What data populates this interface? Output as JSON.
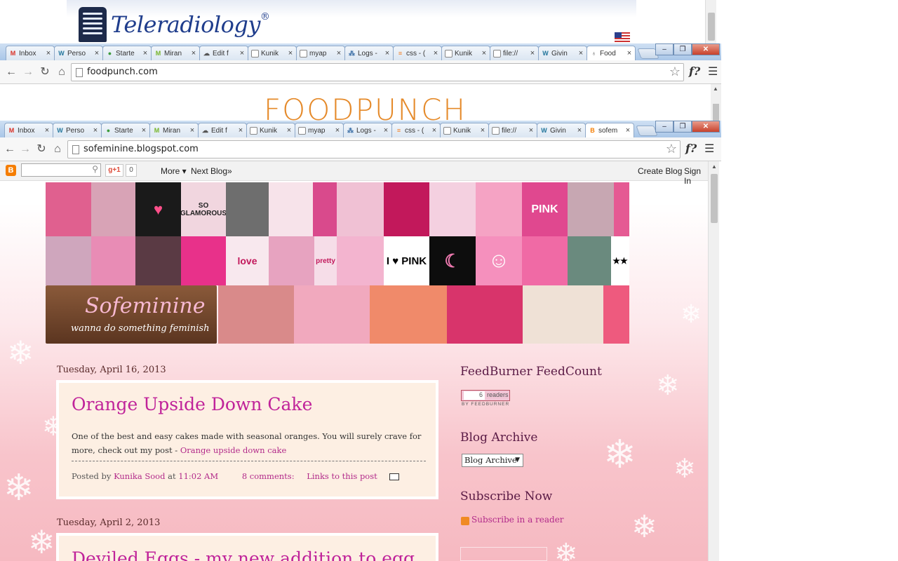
{
  "window1": {
    "logo_text": "Teleradiology",
    "logo_mark": "®"
  },
  "window2": {
    "tabs": [
      {
        "label": "Inbox",
        "icon": "gmail-icon"
      },
      {
        "label": "Perso",
        "icon": "wordpress-icon"
      },
      {
        "label": "Starte",
        "icon": "chrome-icon"
      },
      {
        "label": "Miran",
        "icon": "site-icon"
      },
      {
        "label": "Edit f",
        "icon": "cloud-icon"
      },
      {
        "label": "Kunik",
        "icon": "page-icon"
      },
      {
        "label": "myap",
        "icon": "page-icon"
      },
      {
        "label": "Logs -",
        "icon": "network-icon"
      },
      {
        "label": "css - (",
        "icon": "stack-icon"
      },
      {
        "label": "Kunik",
        "icon": "page-icon"
      },
      {
        "label": "file://",
        "icon": "page-icon"
      },
      {
        "label": "Givin",
        "icon": "wordpress-icon"
      },
      {
        "label": "Food",
        "icon": "foodpunch-icon"
      }
    ],
    "url": "foodpunch.com",
    "site_title": "FOODPUNCH"
  },
  "window3": {
    "tabs": [
      {
        "label": "Inbox",
        "icon": "gmail-icon"
      },
      {
        "label": "Perso",
        "icon": "wordpress-icon"
      },
      {
        "label": "Starte",
        "icon": "chrome-icon"
      },
      {
        "label": "Miran",
        "icon": "site-icon"
      },
      {
        "label": "Edit f",
        "icon": "cloud-icon"
      },
      {
        "label": "Kunik",
        "icon": "page-icon"
      },
      {
        "label": "myap",
        "icon": "page-icon"
      },
      {
        "label": "Logs -",
        "icon": "network-icon"
      },
      {
        "label": "css - (",
        "icon": "stack-icon"
      },
      {
        "label": "Kunik",
        "icon": "page-icon"
      },
      {
        "label": "file://",
        "icon": "page-icon"
      },
      {
        "label": "Givin",
        "icon": "wordpress-icon"
      },
      {
        "label": "sofem",
        "icon": "blogger-icon"
      }
    ],
    "url": "sofeminine.blogspot.com"
  },
  "navbar": {
    "gplus": "g+1",
    "count": "0",
    "more": "More ▾",
    "next_blog": "Next Blog»",
    "create_blog": "Create Blog",
    "sign_in": "Sign In"
  },
  "header": {
    "blog_title": "Sofeminine",
    "tagline": "wanna do something feminish",
    "tiles": [
      "SO GLAMOROUS",
      "PINK",
      "PINK",
      "I ♥ PINK",
      "love",
      "pretty",
      "pink"
    ]
  },
  "posts": [
    {
      "date": "Tuesday, April 16, 2013",
      "title": "Orange Upside Down Cake",
      "body": "One of the best and easy cakes made with seasonal oranges. You will surely crave for more, check out my post - ",
      "body_link": "Orange upside down cake",
      "posted_by": "Posted by ",
      "author": "Kunika Sood",
      "at": " at ",
      "time": "11:02 AM",
      "comments": "8 comments:",
      "links": "Links to this post"
    },
    {
      "date": "Tuesday, April 2, 2013",
      "title": "Deviled Eggs - my new addition to egg recipes"
    }
  ],
  "sidebar": {
    "feedcount_title": "FeedBurner FeedCount",
    "readers_count": "6",
    "readers_label": "readers",
    "feedburner_label": "BY FEEDBURNER",
    "archive_title": "Blog Archive",
    "archive_select": "Blog Archive",
    "subscribe_title": "Subscribe Now",
    "subscribe_link": "Subscribe in a reader"
  }
}
